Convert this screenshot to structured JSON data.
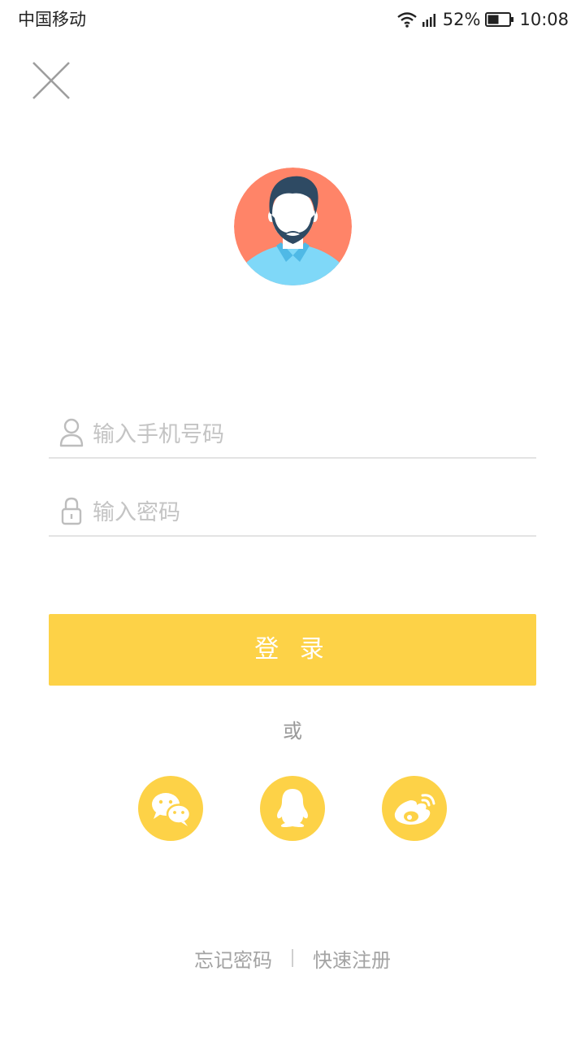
{
  "status_bar": {
    "carrier": "中国移动",
    "battery_percent": "52%",
    "time": "10:08",
    "battery_level": 0.52
  },
  "close": {
    "icon": "close-icon"
  },
  "avatar": {
    "icon": "user-avatar"
  },
  "form": {
    "phone": {
      "placeholder": "输入手机号码",
      "value": "",
      "icon": "user-icon"
    },
    "password": {
      "placeholder": "输入密码",
      "value": "",
      "icon": "lock-icon"
    }
  },
  "login_button": {
    "label": "登 录"
  },
  "or_text": "或",
  "social": [
    {
      "name": "wechat",
      "icon": "wechat-icon"
    },
    {
      "name": "qq",
      "icon": "qq-icon"
    },
    {
      "name": "weibo",
      "icon": "weibo-icon"
    }
  ],
  "links": {
    "forgot_password": "忘记密码",
    "quick_register": "快速注册"
  },
  "colors": {
    "accent": "#fdd247",
    "avatar_bg": "#ff8468",
    "shirt": "#7fd8f8",
    "hair": "#2e4a63",
    "placeholder": "#c4c4c4",
    "divider": "#e3e3e3"
  }
}
